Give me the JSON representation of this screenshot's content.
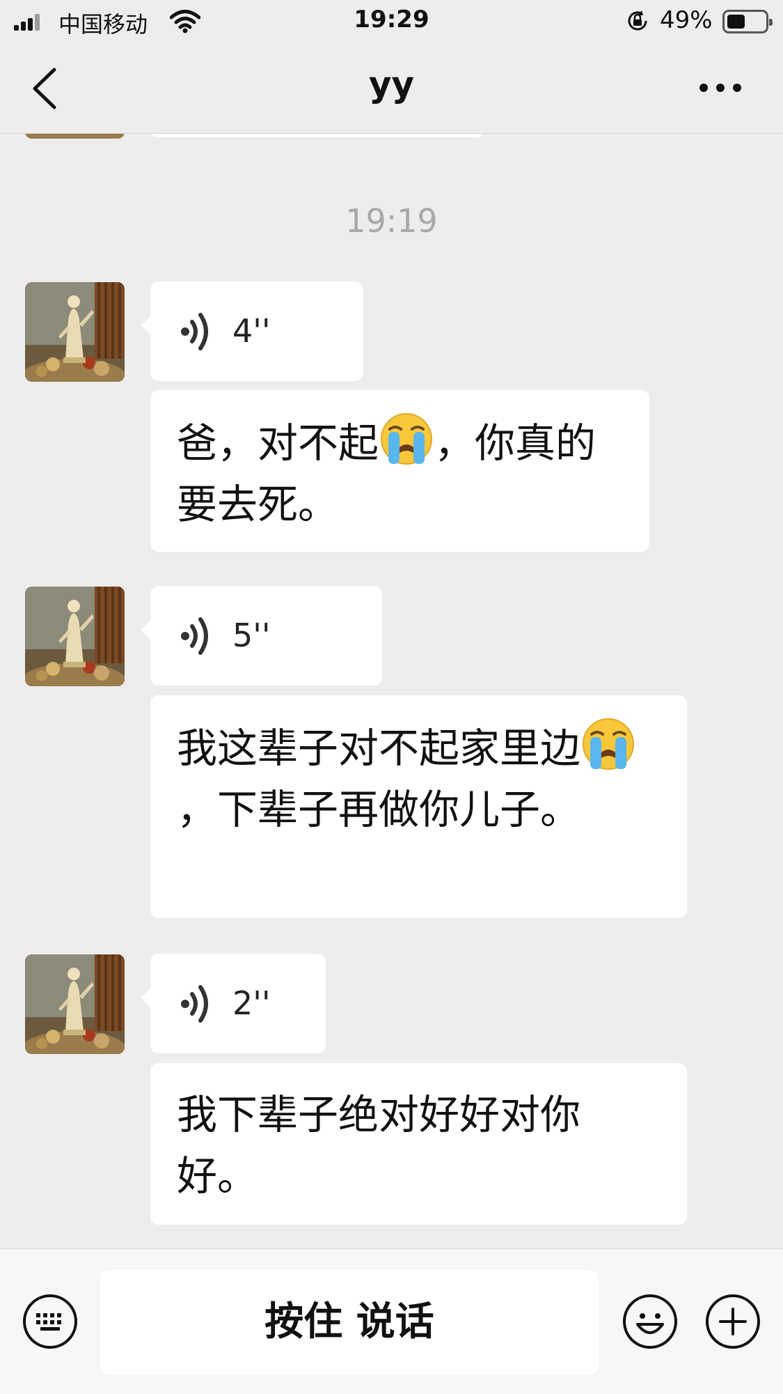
{
  "status_bar": {
    "carrier": "中国移动",
    "time": "19:29",
    "battery_percent": "49%",
    "battery_level": 0.49,
    "icons": [
      "signal-icon",
      "wifi-icon",
      "orientation-lock-icon",
      "battery-icon"
    ]
  },
  "nav": {
    "title": "yy",
    "icons": [
      "back-chevron-icon",
      "more-icon"
    ]
  },
  "chat": {
    "timestamp": "19:19",
    "messages": [
      {
        "type": "voice",
        "duration": "4''"
      },
      {
        "type": "text",
        "text_parts": [
          "爸，对不起",
          "，你真的要去死。"
        ],
        "emoji": "loudly-crying-face"
      },
      {
        "type": "voice",
        "duration": "5''"
      },
      {
        "type": "text",
        "text_parts": [
          "我这辈子对不起家里边",
          "，下辈子再做你儿子。"
        ],
        "emoji": "loudly-crying-face"
      },
      {
        "type": "voice",
        "duration": "2''"
      },
      {
        "type": "text",
        "text": "我下辈子绝对好好对你好。"
      }
    ]
  },
  "toolbar": {
    "hold_to_talk": "按住 说话",
    "icons": [
      "keyboard-icon",
      "emoji-icon",
      "plus-icon"
    ]
  },
  "colors": {
    "background": "#ededed",
    "bubble": "#ffffff",
    "timestamp": "#a8a8a8",
    "toolbar": "#f7f7f7"
  }
}
